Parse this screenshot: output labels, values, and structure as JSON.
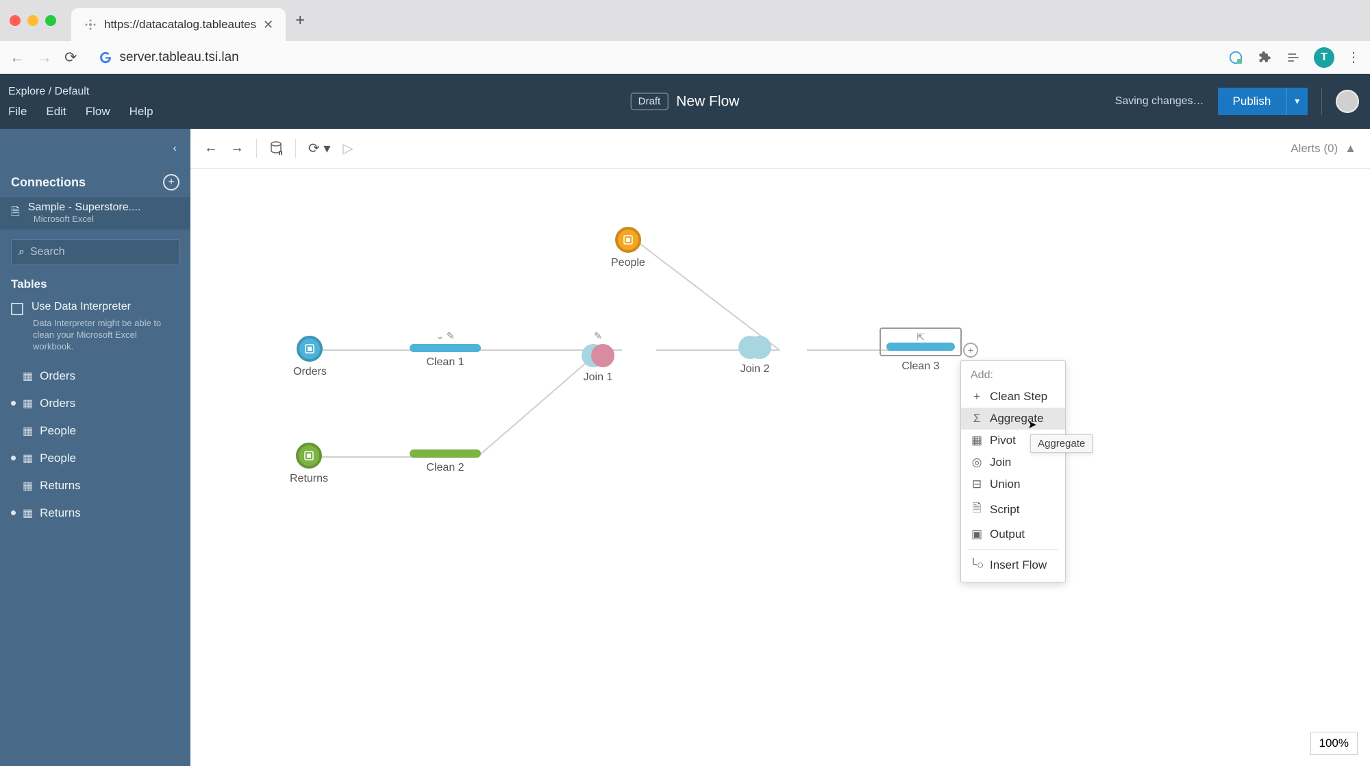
{
  "browser": {
    "tab_title": "https://datacatalog.tableautes",
    "url": "server.tableau.tsi.lan",
    "avatar_letter": "T"
  },
  "header": {
    "breadcrumb_explore": "Explore",
    "breadcrumb_sep": " / ",
    "breadcrumb_default": "Default",
    "menu": {
      "file": "File",
      "edit": "Edit",
      "flow": "Flow",
      "help": "Help"
    },
    "draft": "Draft",
    "flow_title": "New Flow",
    "saving": "Saving changes…",
    "publish": "Publish"
  },
  "sidebar": {
    "connections_title": "Connections",
    "connection": {
      "name": "Sample - Superstore....",
      "type": "Microsoft Excel"
    },
    "search_placeholder": "Search",
    "tables_title": "Tables",
    "interpreter_label": "Use Data Interpreter",
    "interpreter_help": "Data Interpreter might be able to clean your Microsoft Excel workbook.",
    "tables": [
      {
        "label": "Orders",
        "bullet": false
      },
      {
        "label": "Orders",
        "bullet": true
      },
      {
        "label": "People",
        "bullet": false
      },
      {
        "label": "People",
        "bullet": true
      },
      {
        "label": "Returns",
        "bullet": false
      },
      {
        "label": "Returns",
        "bullet": true
      }
    ]
  },
  "canvas": {
    "alerts_label": "Alerts (0)",
    "nodes": {
      "people": "People",
      "orders": "Orders",
      "returns": "Returns",
      "clean1": "Clean 1",
      "clean2": "Clean 2",
      "clean3": "Clean 3",
      "join1": "Join 1",
      "join2": "Join 2"
    },
    "zoom": "100%"
  },
  "ctx_menu": {
    "title": "Add:",
    "items": {
      "clean_step": "Clean Step",
      "aggregate": "Aggregate",
      "pivot": "Pivot",
      "join": "Join",
      "union": "Union",
      "script": "Script",
      "output": "Output",
      "insert_flow": "Insert Flow"
    },
    "tooltip": "Aggregate"
  }
}
